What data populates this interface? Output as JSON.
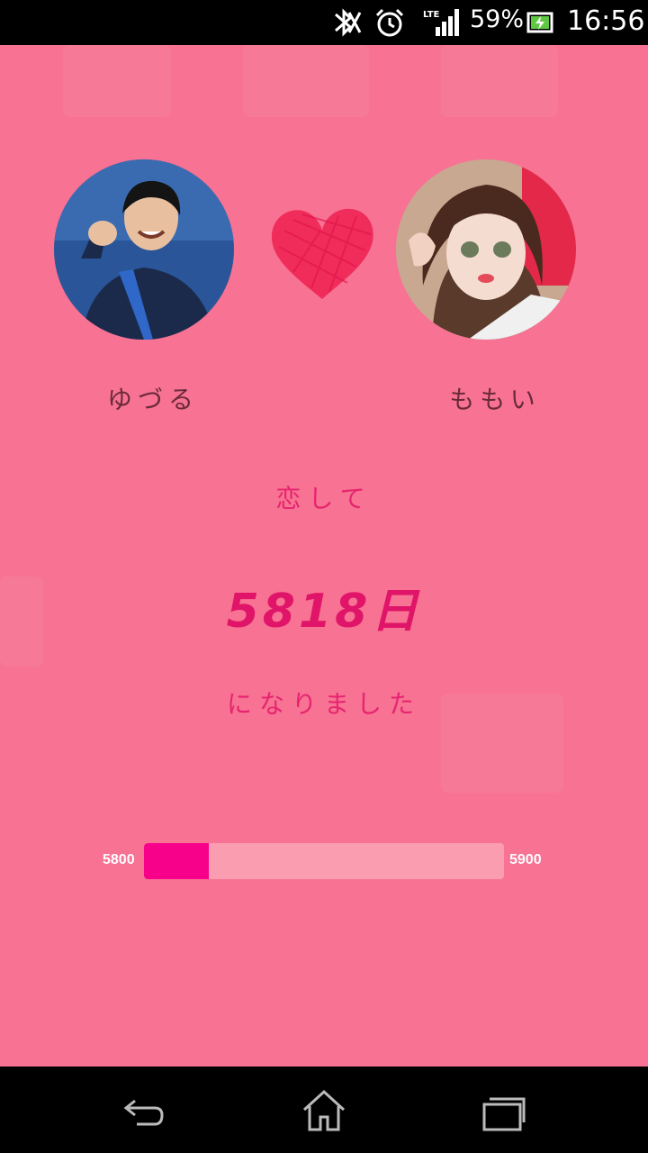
{
  "status_bar": {
    "battery_percent": "59%",
    "time": "16:56",
    "network": "LTE",
    "icons": [
      "bluetooth-off-icon",
      "alarm-icon",
      "signal-icon",
      "battery-charging-icon"
    ]
  },
  "couple": {
    "left": {
      "name": "ゆづる",
      "avatar": "person-avatar"
    },
    "right": {
      "name": "ももい",
      "avatar": "person-avatar"
    },
    "heart_icon": "heart-icon"
  },
  "counter": {
    "line1": "恋して",
    "days": "5818日",
    "line2": "になりました"
  },
  "progress": {
    "min_label": "5800",
    "max_label": "5900",
    "min": 5800,
    "max": 5900,
    "value": 5818,
    "fill_color": "#f7008a",
    "track_color": "#fb9db1"
  },
  "colors": {
    "background": "#f77293",
    "text_pink": "#e6246f",
    "name_text": "#6b2a3a"
  },
  "nav_bar": {
    "icons": [
      "back-icon",
      "home-icon",
      "recent-apps-icon"
    ]
  }
}
